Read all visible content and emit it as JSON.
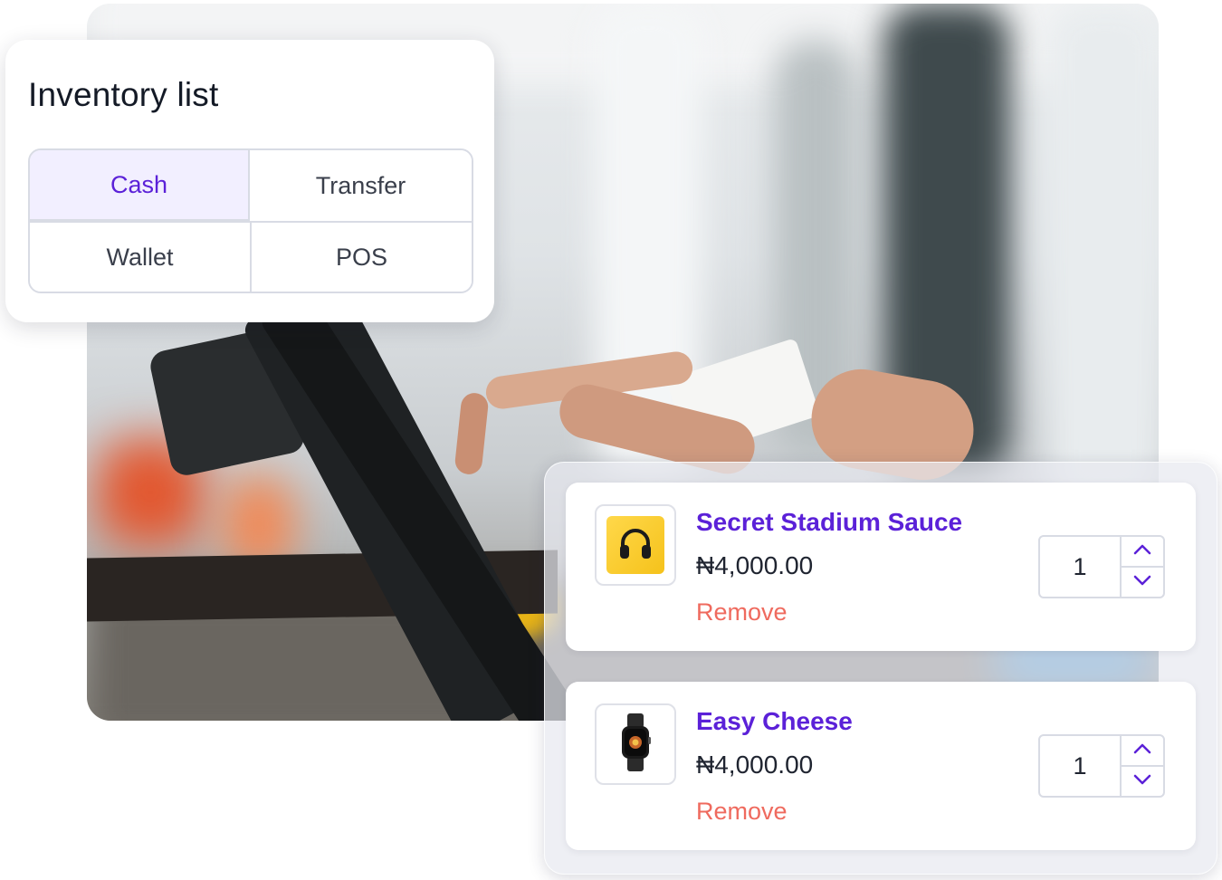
{
  "inventory": {
    "title": "Inventory list",
    "payment_methods": [
      "Cash",
      "Transfer",
      "Wallet",
      "POS"
    ],
    "selected": "Cash"
  },
  "cart": {
    "items": [
      {
        "name": "Secret Stadium Sauce",
        "price": "₦4,000.00",
        "remove_label": "Remove",
        "quantity": "1",
        "thumbnail_icon": "headphones-icon"
      },
      {
        "name": "Easy Cheese",
        "price": "₦4,000.00",
        "remove_label": "Remove",
        "quantity": "1",
        "thumbnail_icon": "smartwatch-icon"
      }
    ]
  },
  "colors": {
    "accent": "#5b21d8",
    "selected_bg": "#f2efff",
    "remove": "#ef6a5e"
  }
}
